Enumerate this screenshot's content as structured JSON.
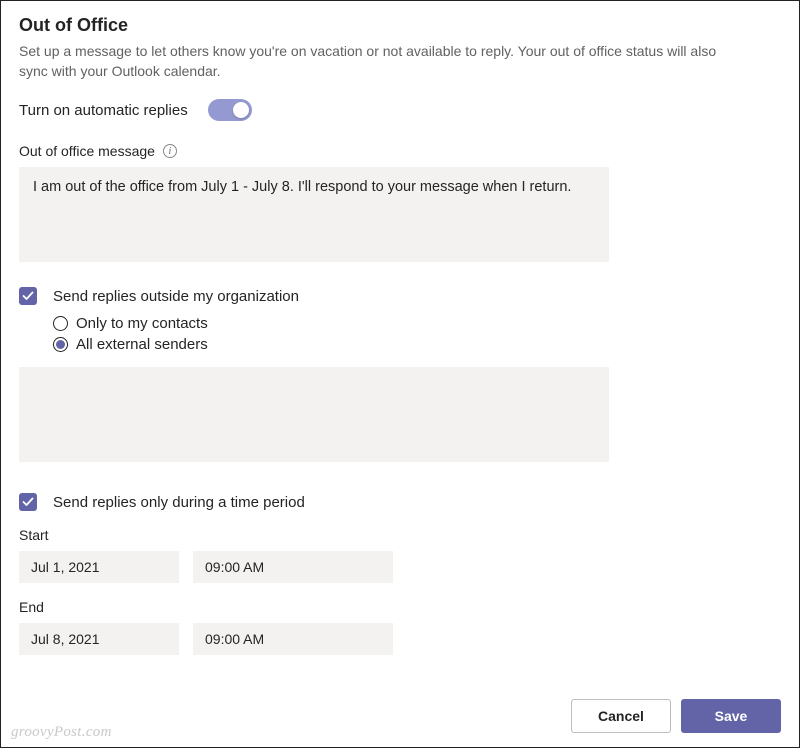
{
  "title": "Out of Office",
  "subtitle": "Set up a message to let others know you're on vacation or not available to reply. Your out of office status will also sync with your Outlook calendar.",
  "toggle": {
    "label": "Turn on automatic replies",
    "on": true
  },
  "message": {
    "label": "Out of office message",
    "value": "I am out of the office from July 1 - July 8. I'll respond to your message when I return."
  },
  "sendOutside": {
    "checked": true,
    "label": "Send replies outside my organization",
    "options": {
      "contacts": "Only to my contacts",
      "all": "All external senders",
      "selected": "all"
    },
    "externalMessage": ""
  },
  "timePeriod": {
    "checked": true,
    "label": "Send replies only during a time period",
    "startLabel": "Start",
    "startDate": "Jul 1, 2021",
    "startTime": "09:00 AM",
    "endLabel": "End",
    "endDate": "Jul 8, 2021",
    "endTime": "09:00 AM"
  },
  "buttons": {
    "cancel": "Cancel",
    "save": "Save"
  },
  "watermark": "groovyPost.com"
}
